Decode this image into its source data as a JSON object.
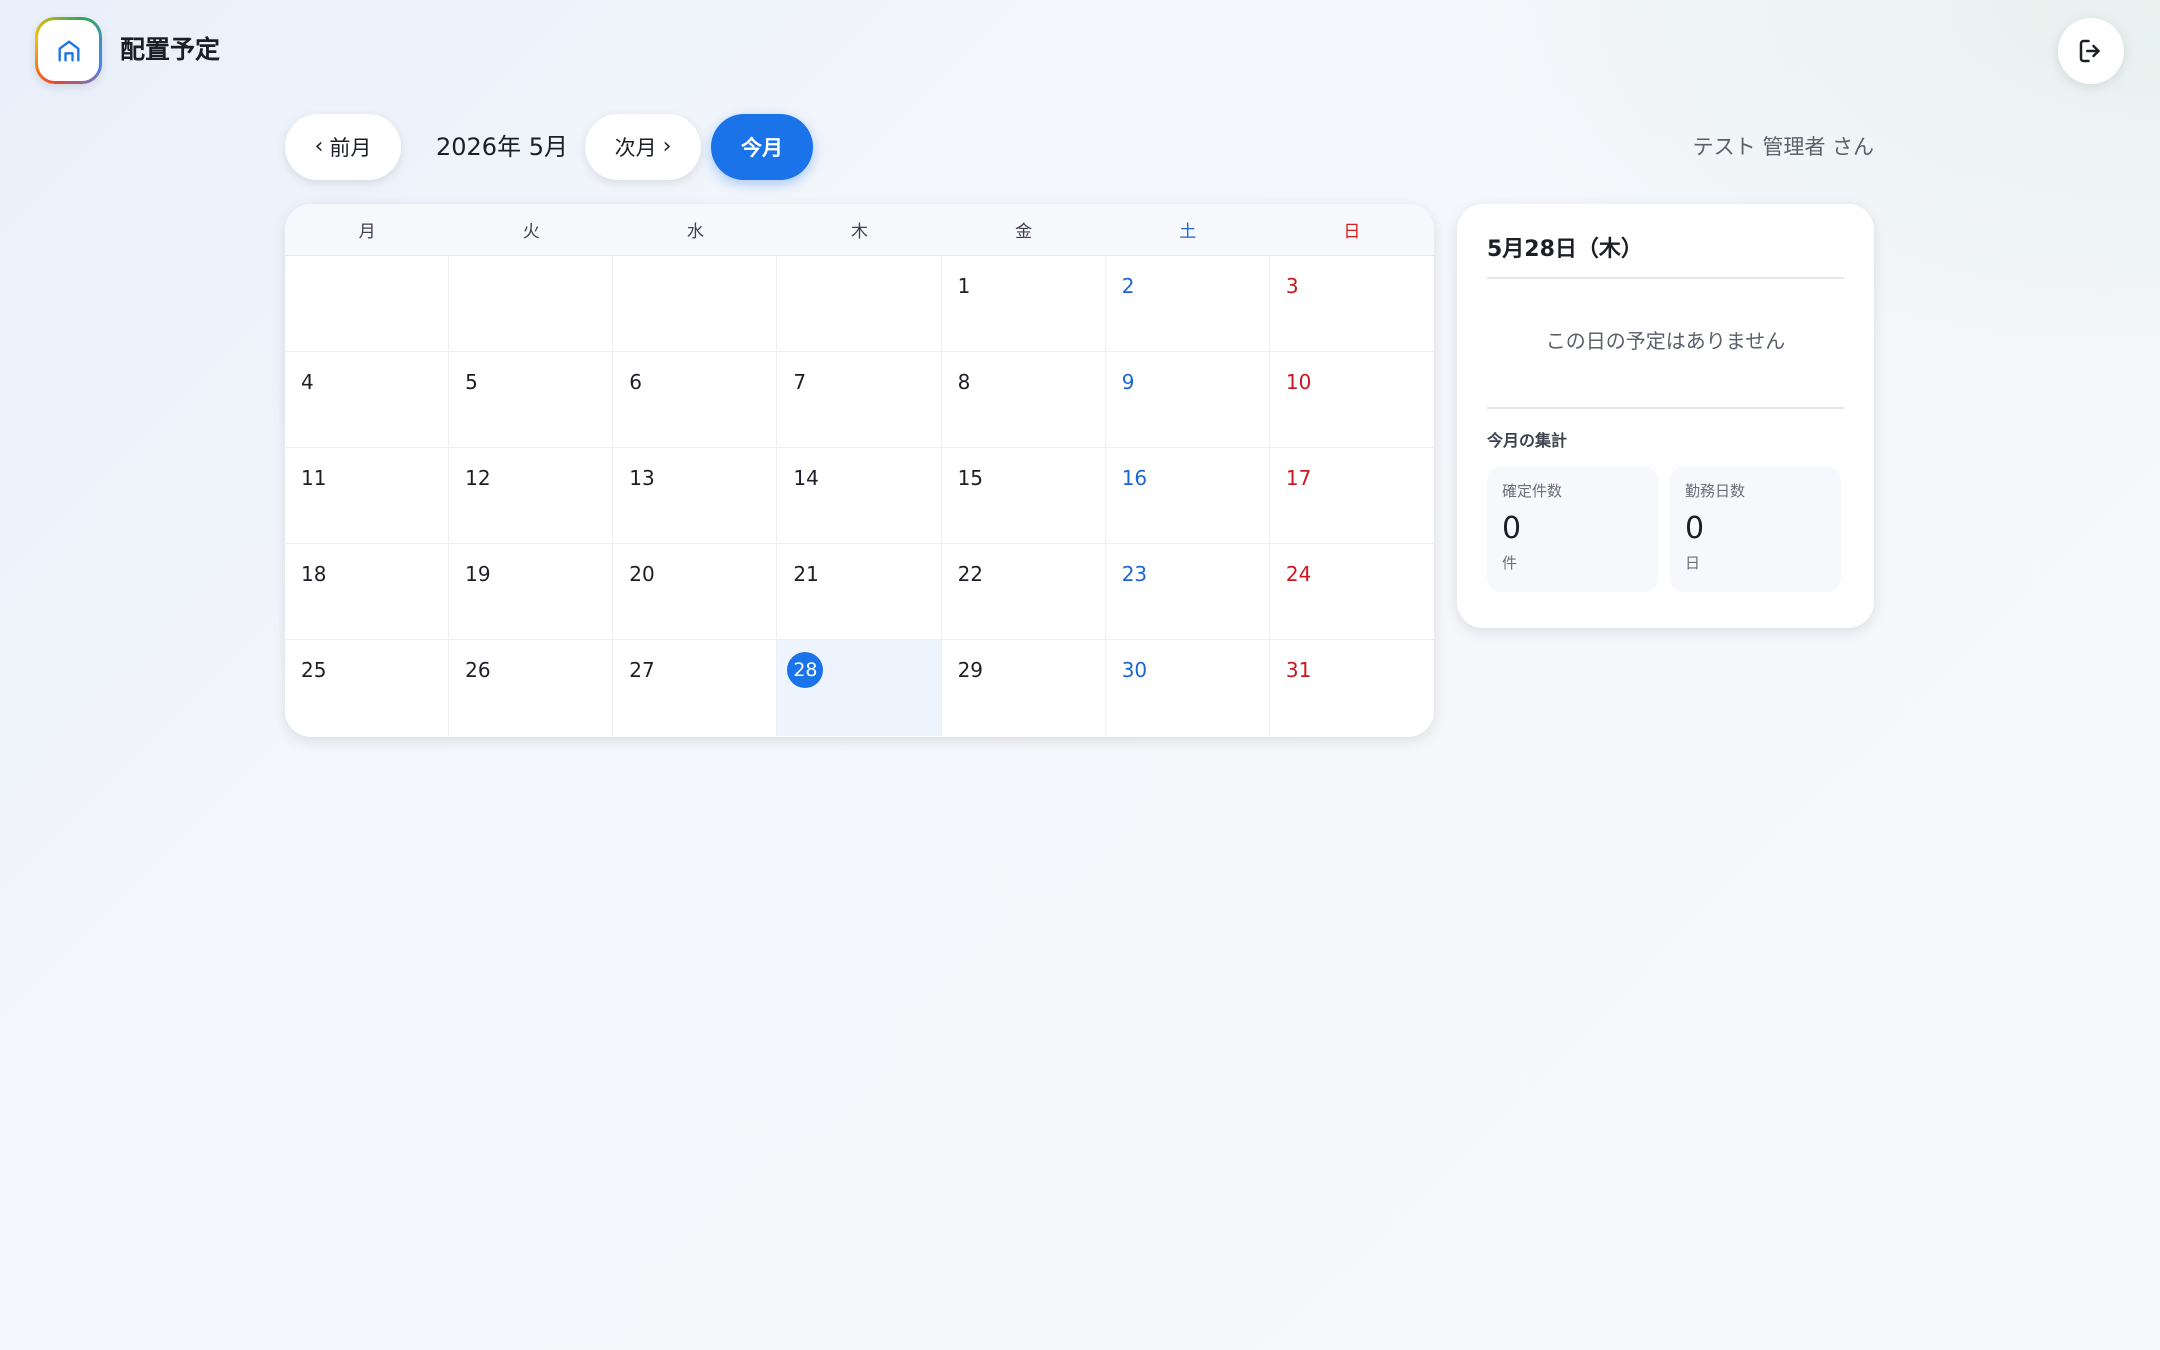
{
  "app": {
    "title": "配置予定",
    "logo_icon": "home-icon"
  },
  "header": {
    "logout_icon": "logout-icon"
  },
  "toolbar": {
    "prev_label": "前月",
    "month_label": "2026年 5月",
    "next_label": "次月",
    "today_label": "今月",
    "user_label": "テスト 管理者 さん"
  },
  "calendar": {
    "weekdays": [
      "月",
      "火",
      "水",
      "木",
      "金",
      "土",
      "日"
    ],
    "leading_blanks": 4,
    "days_in_month": 31,
    "selected_day": 28,
    "colors": {
      "saturday": "#1a66d2",
      "sunday": "#c9191f",
      "accent": "#1a73e8"
    }
  },
  "panel": {
    "date_title": "5月28日（木）",
    "empty_message": "この日の予定はありません",
    "summary_title": "今月の集計",
    "stats": [
      {
        "label": "確定件数",
        "value": "0",
        "unit": "件"
      },
      {
        "label": "勤務日数",
        "value": "0",
        "unit": "日"
      }
    ]
  }
}
